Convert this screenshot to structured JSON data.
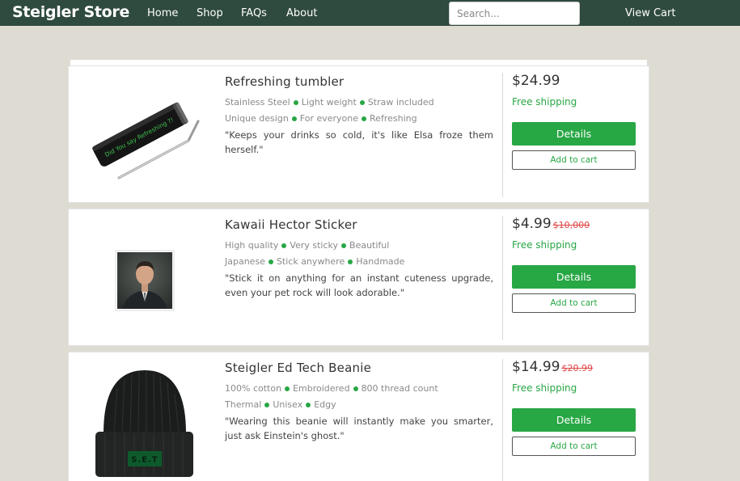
{
  "nav": {
    "brand": "Steigler Store",
    "links": [
      "Home",
      "Shop",
      "FAQs",
      "About"
    ],
    "search_placeholder": "Search...",
    "cart": "View Cart"
  },
  "products": [
    {
      "title": "Refreshing tumbler",
      "tags_line1": [
        "Stainless Steel",
        "Light weight",
        "Straw included"
      ],
      "tags_line2": [
        "Unique design",
        "For everyone",
        "Refreshing"
      ],
      "quote": "\"Keeps your drinks so cold, it's like Elsa froze them herself.\"",
      "price": "$24.99",
      "old_price": "",
      "image_text": "Did You say Refreshing ?!",
      "shipping": "Free shipping",
      "details_label": "Details",
      "cart_label": "Add to cart"
    },
    {
      "title": "Kawaii Hector Sticker",
      "tags_line1": [
        "High quality",
        "Very sticky",
        "Beautiful"
      ],
      "tags_line2": [
        "Japanese",
        "Stick anywhere",
        "Handmade"
      ],
      "quote": "\"Stick it on anything for an instant cuteness upgrade, even your pet rock will look adorable.\"",
      "price": "$4.99",
      "old_price": "$10,000",
      "image_text": "",
      "shipping": "Free shipping",
      "details_label": "Details",
      "cart_label": "Add to cart"
    },
    {
      "title": "Steigler Ed Tech Beanie",
      "tags_line1": [
        "100% cotton",
        "Embroidered",
        "800 thread count"
      ],
      "tags_line2": [
        "Thermal",
        "Unisex",
        "Edgy"
      ],
      "quote": "\"Wearing this beanie will instantly make you smarter, just ask Einstein's ghost.\"",
      "price": "$14.99",
      "old_price": "$20.99",
      "image_text": "S.E.T",
      "shipping": "Free shipping",
      "details_label": "Details",
      "cart_label": "Add to cart"
    }
  ],
  "colors": {
    "navbar": "#2f4a3e",
    "background": "#dedcd2",
    "accent_green": "#28a745",
    "strike_red": "#e04646"
  }
}
